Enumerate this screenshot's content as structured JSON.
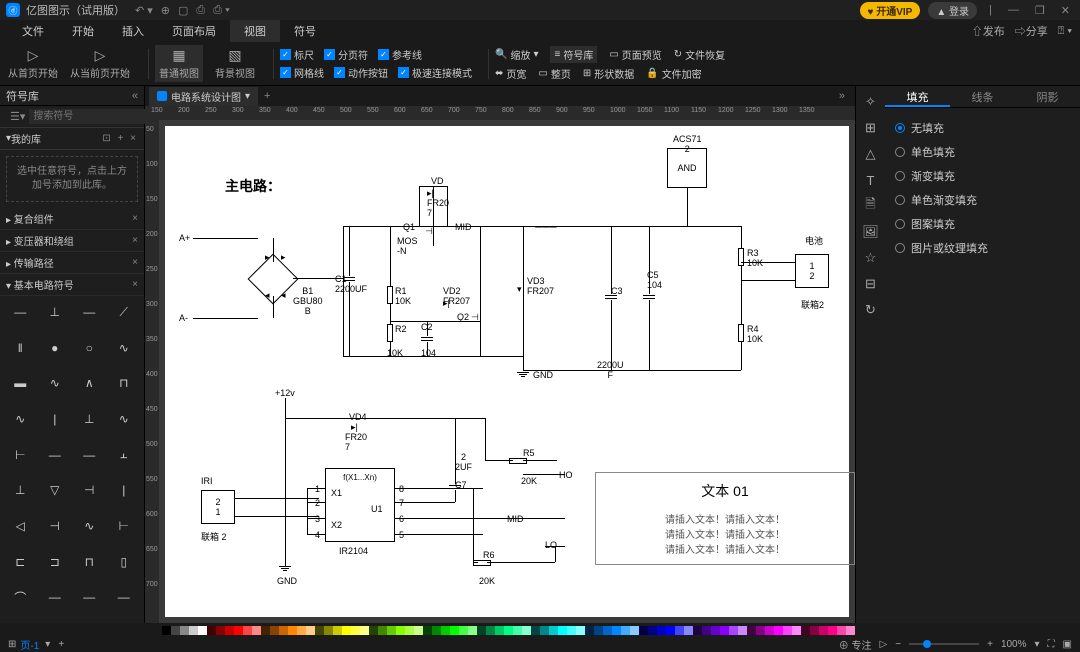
{
  "app": {
    "title": "亿图图示（试用版）"
  },
  "titlebar_right": {
    "vip": "♥ 开通VIP",
    "login": "▲ 登录"
  },
  "menu": {
    "items": [
      "文件",
      "开始",
      "插入",
      "页面布局",
      "视图",
      "符号"
    ],
    "active": 4,
    "publish": "⇧发布",
    "share": "⇨分享"
  },
  "toolbar": {
    "from_first": "从首页开始",
    "from_current": "从当前页开始",
    "view_normal": "普通视图",
    "view_bg": "背景视图",
    "chk_ruler": "标尺",
    "chk_page": "分页符",
    "chk_guide": "参考线",
    "chk_grid": "网格线",
    "chk_action": "动作按钮",
    "chk_fast": "极速连接模式",
    "zoom": "缩放",
    "symlib": "符号库",
    "preview": "页面预览",
    "restore": "文件恢复",
    "pagew": "页宽",
    "whole": "整页",
    "shapedata": "形状数据",
    "encrypt": "文件加密"
  },
  "left": {
    "header": "符号库",
    "search_ph": "搜索符号",
    "mylib": "我的库",
    "hint": "选中任意符号，点击上方加号添加到此库。",
    "cats": [
      "复合组件",
      "变压器和绕组",
      "传输路径",
      "基本电路符号"
    ]
  },
  "tab": {
    "name": "电路系统设计图"
  },
  "ruler_h": [
    "150",
    "200",
    "250",
    "300",
    "350",
    "400",
    "450",
    "500",
    "550",
    "600",
    "650",
    "700",
    "750",
    "800",
    "850",
    "900",
    "950",
    "1000",
    "1050",
    "1100",
    "1150",
    "1200",
    "1250",
    "1300",
    "1350"
  ],
  "ruler_v": [
    "50",
    "100",
    "150",
    "200",
    "250",
    "300",
    "350",
    "400",
    "450",
    "500",
    "550",
    "600",
    "650",
    "700"
  ],
  "schematic": {
    "title": "主电路：",
    "a_plus": "A+",
    "a_minus": "A-",
    "b1": "B1\nGBU80\nB",
    "c1": "C1\n2200UF",
    "r1": "R1\n10K",
    "r2": "R2",
    "r2b": "10K",
    "c2": "C2",
    "c2b": "104",
    "vd": "VD",
    "fr207a": "FR20\n7",
    "q1": "Q1",
    "mosn": "MOS\n-N",
    "mid1": "MID",
    "vd2": "VD2\nFR207",
    "q2": "Q2",
    "vd3": "VD3\nFR207",
    "c3": "C3",
    "gnd1": "GND",
    "c3b": "2200U\nF",
    "c5": "C5\n104",
    "r3": "R3\n10K",
    "r4": "R4\n10K",
    "acs": "ACS71\n2",
    "and": "AND",
    "batt": "电池",
    "batt12": "1\n2",
    "conn2": "联箱2",
    "v12": "+12v",
    "vd4": "VD4",
    "fr207b": "FR20\n7",
    "iri": "IRI",
    "iri21": "2\n1",
    "conn2b": "联箱 2",
    "u1": "U1",
    "fx": "f(X1...Xn)",
    "x1": "X1",
    "x2": "X2",
    "ir2104": "IR2104",
    "p1": "1",
    "p2": "2",
    "p3": "3",
    "p4": "4",
    "p5": "5",
    "p6": "6",
    "p7": "7",
    "p8": "8",
    "c7": "C7",
    "c7v": "2\n2UF",
    "r5": "R5",
    "r5v": "20K",
    "r6": "R6",
    "r6v": "20K",
    "ho": "HO",
    "mid2": "MID",
    "lo": "LO",
    "gnd2": "GND",
    "txt_title": "文本 01",
    "txt_body": "请插入文本！请插入文本！\n请插入文本！请插入文本！\n请插入文本！请插入文本！"
  },
  "right": {
    "tabs": [
      "填充",
      "线条",
      "阴影"
    ],
    "active": 0,
    "opts": [
      "无填充",
      "单色填充",
      "渐变填充",
      "单色渐变填充",
      "图案填充",
      "图片或纹理填充"
    ],
    "selected": 0
  },
  "status": {
    "page": "页-1",
    "focus": "⊕ 专注",
    "zoom": "100%"
  },
  "palette": [
    "#000",
    "#444",
    "#888",
    "#ccc",
    "#fff",
    "#400",
    "#800",
    "#c00",
    "#f00",
    "#f44",
    "#f88",
    "#420",
    "#840",
    "#c60",
    "#f80",
    "#fa4",
    "#fc8",
    "#440",
    "#880",
    "#cc0",
    "#ff0",
    "#ff4",
    "#ff8",
    "#240",
    "#480",
    "#6c0",
    "#8f0",
    "#af4",
    "#cf8",
    "#040",
    "#080",
    "#0c0",
    "#0f0",
    "#4f4",
    "#8f8",
    "#042",
    "#084",
    "#0c6",
    "#0f8",
    "#4fa",
    "#8fc",
    "#044",
    "#088",
    "#0cc",
    "#0ff",
    "#4ff",
    "#8ff",
    "#024",
    "#048",
    "#06c",
    "#08f",
    "#4af",
    "#8cf",
    "#004",
    "#008",
    "#00c",
    "#00f",
    "#44f",
    "#88f",
    "#204",
    "#408",
    "#60c",
    "#80f",
    "#a4f",
    "#c8f",
    "#404",
    "#808",
    "#c0c",
    "#f0f",
    "#f4f",
    "#f8f",
    "#402",
    "#804",
    "#c06",
    "#f08",
    "#f4a",
    "#f8c"
  ]
}
